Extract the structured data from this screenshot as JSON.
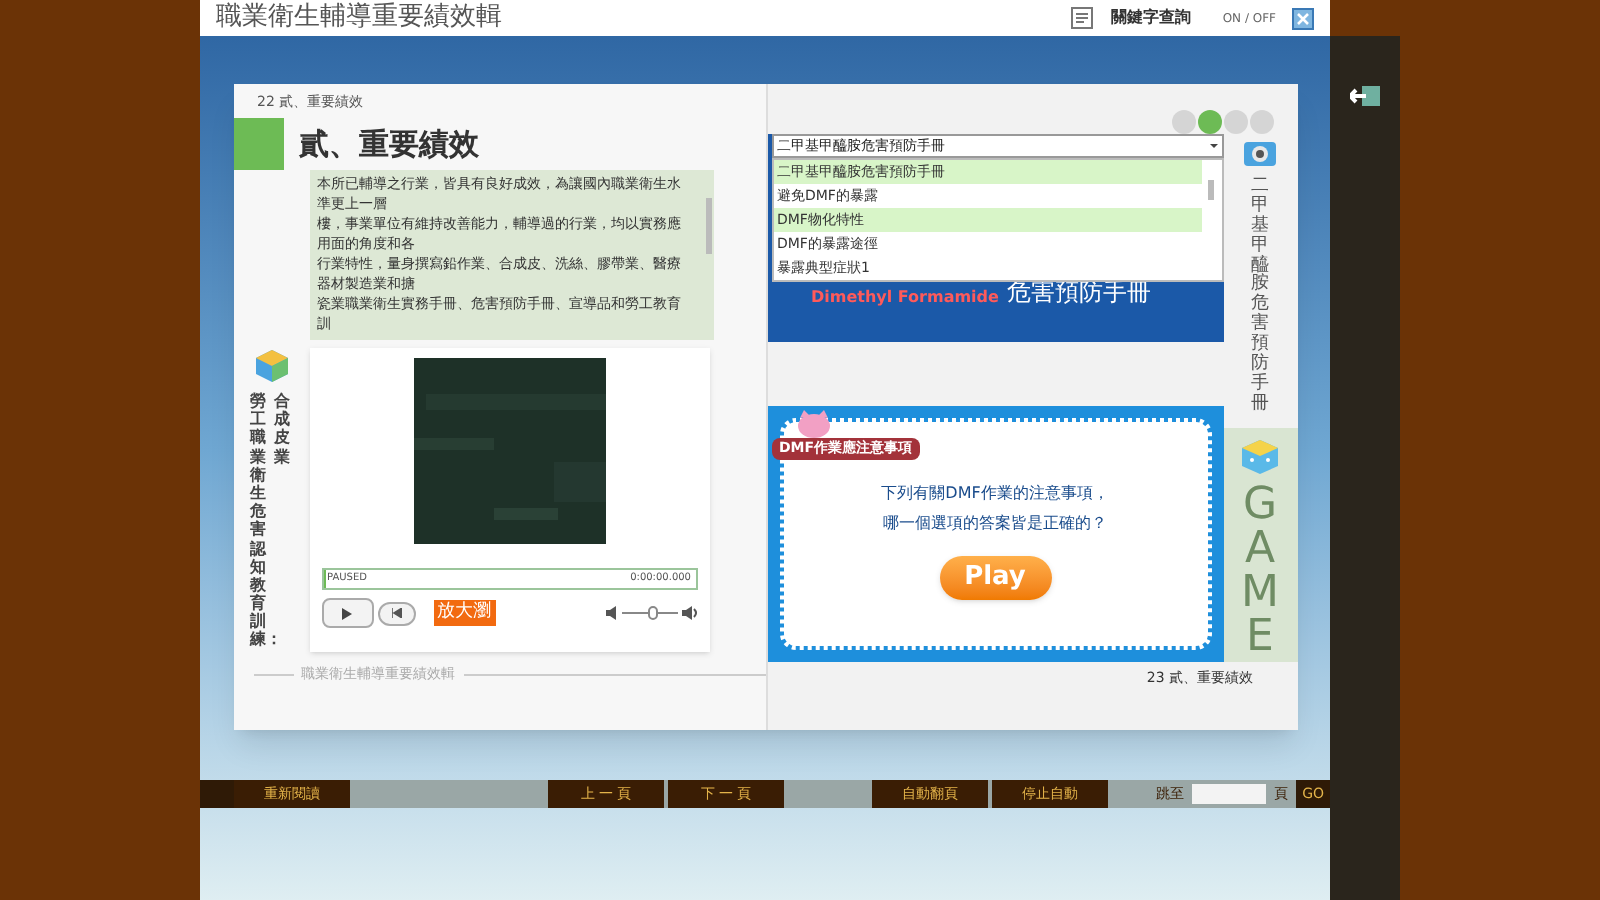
{
  "window": {
    "title": "職業衛生輔導重要績效輯"
  },
  "toolbar": {
    "search_label": "關鍵字查詢",
    "toggle_label": "ON / OFF"
  },
  "left_page": {
    "page_label": "22 貳、重要績效",
    "heading": "貳、重要績效",
    "paragraphs": [
      "本所已輔導之行業，皆具有良好成效，為讓國內職業衛生水準更上一層",
      "樓，事業單位有維持改善能力，輔導過的行業，均以實務應用面的角度和各",
      "行業特性，量身撰寫鉛作業、合成皮、洗絲、膠帶業、醫療器材製造業和搪",
      "瓷業職業衛生實務手冊、危害預防手冊、宣導品和勞工教育訓"
    ],
    "side_captions": [
      "勞工職業衛生危害認知教育訓練：",
      "合成皮業"
    ],
    "player": {
      "progress": {
        "level": 0.01
      },
      "status": "PAUSED",
      "time": "0:00:00.000",
      "zoom_button": "放大瀏",
      "volume": {
        "level": 0.6
      }
    },
    "footer": "職業衛生輔導重要績效輯"
  },
  "right_page": {
    "page_dots": [
      {
        "selected": false
      },
      {
        "selected": true
      },
      {
        "selected": false
      },
      {
        "selected": false
      }
    ],
    "dropdown": {
      "value": "二甲基甲醯胺危害預防手冊",
      "options": [
        {
          "label": "二甲基甲醯胺危害預防手冊",
          "selected": true
        },
        {
          "label": "避免DMF的暴露",
          "selected": false
        },
        {
          "label": "DMF物化特性",
          "selected": true
        },
        {
          "label": "DMF的暴露途徑",
          "selected": false
        },
        {
          "label": "暴露典型症狀1",
          "selected": false
        }
      ]
    },
    "banner": {
      "english": "Dimethyl Formamide",
      "title": "危害預防手冊"
    },
    "side_caption": "二甲基甲醯胺危害預防手冊",
    "game": {
      "tag": "DMF作業應注意事項",
      "question": [
        "下列有關DMF作業的注意事項，",
        "哪一個選項的答案皆是正確的？"
      ],
      "play_button": "Play",
      "side_label": "GAME"
    },
    "page_label": "23 貳、重要績效"
  },
  "nav": {
    "buttons": [
      "重新閱讀",
      "上 一 頁",
      "下 一 頁",
      "自動翻頁",
      "停止自動"
    ],
    "goto_label": "跳至",
    "page_unit": "頁",
    "go_button": "GO"
  }
}
